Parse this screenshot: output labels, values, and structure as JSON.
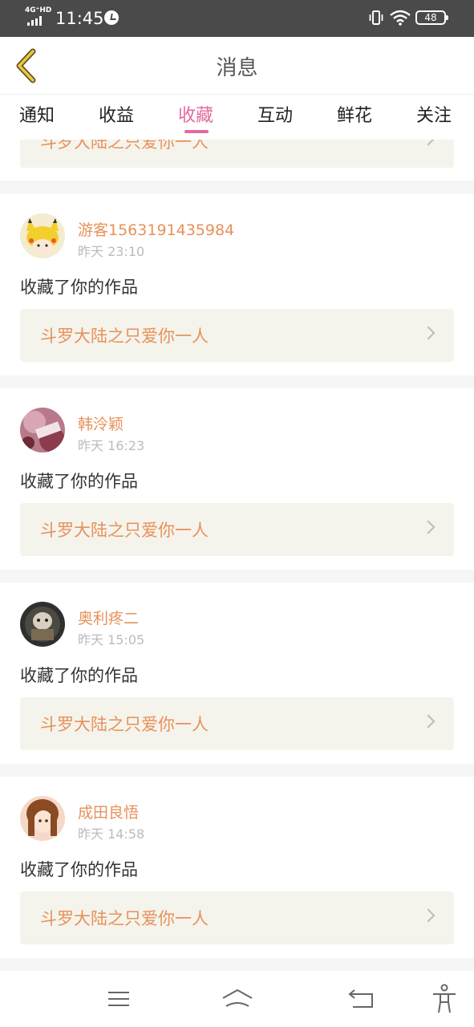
{
  "status_bar": {
    "network": "4G⁺HD",
    "time": "11:45",
    "battery": "48",
    "icons": [
      "signal-icon",
      "alarm-icon",
      "vibrate-icon",
      "wifi-icon",
      "battery-icon"
    ]
  },
  "header": {
    "title": "消息",
    "back_icon": "chevron-left-icon"
  },
  "tabs": [
    {
      "label": "通知",
      "active": false
    },
    {
      "label": "收益",
      "active": false
    },
    {
      "label": "收藏",
      "active": true
    },
    {
      "label": "互动",
      "active": false
    },
    {
      "label": "鲜花",
      "active": false
    },
    {
      "label": "关注",
      "active": false
    }
  ],
  "colors": {
    "accent": "#e26aa0",
    "username": "#e8915a",
    "work_link_bg": "#f4f4ec"
  },
  "partial_card": {
    "work_title": "斗罗大陆之只爱你一人"
  },
  "notifications": [
    {
      "username": "游客1563191435984",
      "time": "昨天 23:10",
      "action": "收藏了你的作品",
      "work_title": "斗罗大陆之只爱你一人"
    },
    {
      "username": "韩泠颖",
      "time": "昨天 16:23",
      "action": "收藏了你的作品",
      "work_title": "斗罗大陆之只爱你一人"
    },
    {
      "username": "奥利疼二",
      "time": "昨天 15:05",
      "action": "收藏了你的作品",
      "work_title": "斗罗大陆之只爱你一人"
    },
    {
      "username": "成田良悟",
      "time": "昨天 14:58",
      "action": "收藏了你的作品",
      "work_title": "斗罗大陆之只爱你一人"
    }
  ],
  "nav_bar": {
    "icons": [
      "menu-icon",
      "home-icon",
      "back-icon",
      "accessibility-icon"
    ]
  }
}
